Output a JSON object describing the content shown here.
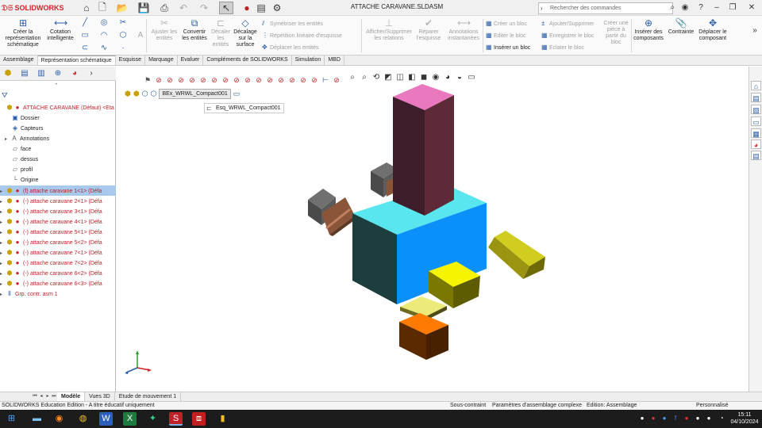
{
  "app": {
    "name": "SOLIDWORKS",
    "doc_title": "ATTACHE CARAVANE.SLDASM"
  },
  "search": {
    "placeholder": "Rechercher des commandes"
  },
  "ribbon": {
    "big_left": [
      {
        "label": "Créer la représentation schématique"
      },
      {
        "label": "Cotation intelligente"
      }
    ],
    "mid_disabled": [
      "Ajuster les entités"
    ],
    "mid_enabled": [
      "Convertir les entités",
      "Décalage sur la surface"
    ],
    "disabled_rows": [
      "Symétriser les entités",
      "Répétition linéaire d'esquisse",
      "Déplacer les entités"
    ],
    "disabled_buttons": [
      "Décaler les entités",
      "Afficher/Supprimer les relations",
      "Réparer l'esquisse",
      "Annotations instantanées"
    ],
    "block_rows": [
      {
        "label": "Créer un bloc",
        "enabled": false
      },
      {
        "label": "Editer le bloc",
        "enabled": false
      },
      {
        "label": "Insérer un bloc",
        "enabled": true
      }
    ],
    "block_rows2": [
      "Ajouter/Supprimer",
      "Enregistrer le bloc",
      "Eclater le bloc"
    ],
    "part_from_block": "Créer une pièce à partir du bloc",
    "right_buttons": [
      {
        "label": "Insérer des composants"
      },
      {
        "label": "Contrainte"
      },
      {
        "label": "Déplacer le composant"
      }
    ]
  },
  "cm_tabs": [
    "Assemblage",
    "Représentation schématique",
    "Esquisse",
    "Marquage",
    "Evaluer",
    "Compléments de SOLIDWORKS",
    "Simulation",
    "MBD"
  ],
  "cm_active": 1,
  "tree": {
    "root": "ATTACHE CARAVANE  (Défaut) <Eta",
    "items": [
      {
        "label": "Dossier",
        "icon": "folder-icon"
      },
      {
        "label": "Capteurs",
        "icon": "sensor-icon"
      },
      {
        "label": "Annotations",
        "icon": "annotation-icon"
      },
      {
        "label": "face",
        "icon": "plane-icon"
      },
      {
        "label": "dessus",
        "icon": "plane-icon"
      },
      {
        "label": "profil",
        "icon": "plane-icon"
      },
      {
        "label": "Origine",
        "icon": "origin-icon"
      }
    ],
    "components": [
      "(f) attache caravane 1<1> (Défa",
      "(-) attache caravane 2<1> (Défa",
      "(-) attache caravane 3<1> (Défa",
      "(-) attache caravane 4<1> (Défa",
      "(-) attache caravane 5<1> (Défa",
      "(-) attache caravane 5<2> (Défa",
      "(-) attache caravane 7<1> (Défa",
      "(-) attache caravane 7<2> (Défa",
      "(-) attache caravane 6<2> (Défa",
      "(-) attache caravane 6<3> (Défa"
    ],
    "mates": "Grp. contr. asm 1"
  },
  "viewport": {
    "breadcrumb": "BEx_WRWL_Compact001",
    "sketch_label": "Esq_WRWL_Compact001"
  },
  "bottom_tabs": [
    "Modèle",
    "Vues 3D",
    "Etude de mouvement 1"
  ],
  "status": {
    "left": "SOLIDWORKS Education Edition - A titre éducatif uniquement",
    "c1": "Sous-contraint",
    "c2": "Paramètres d'assemblage complexe",
    "c3": "Edition: Assemblage",
    "c4": "Personnalisé"
  },
  "clock": {
    "time": "15:11",
    "date": "04/10/2024"
  },
  "colors": {
    "accent": "#2a5da8",
    "red_text": "#c0202a",
    "selection": "#a8c8ec"
  }
}
